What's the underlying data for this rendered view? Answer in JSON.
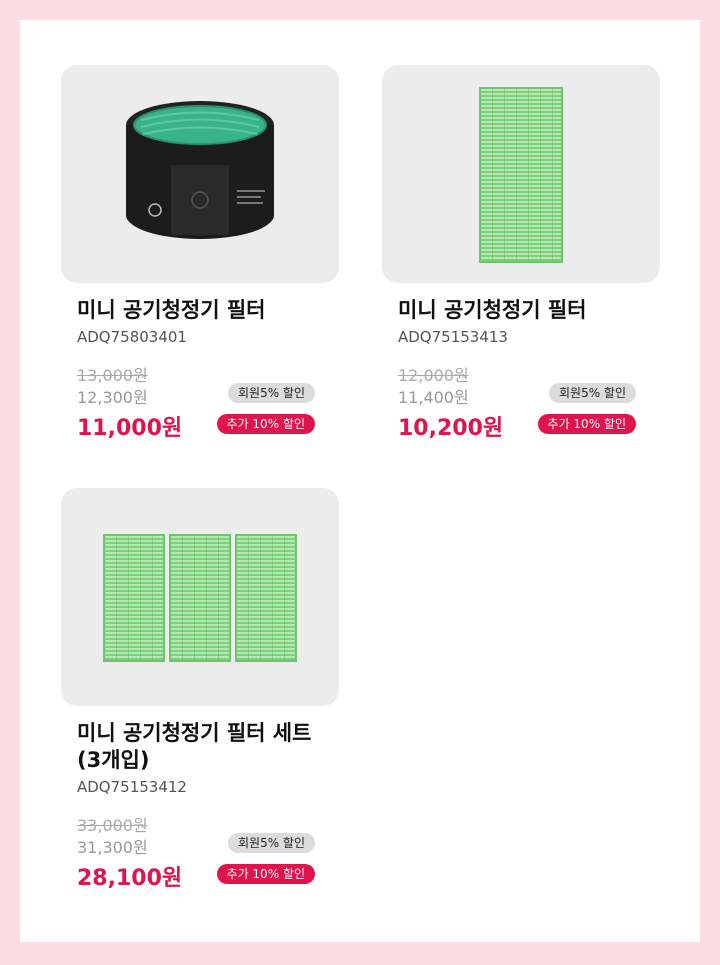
{
  "products": [
    {
      "name": "미니 공기청정기 필터",
      "code": "ADQ75803401",
      "original_price": "13,000원",
      "member_price": "12,300원",
      "final_price": "11,000원",
      "member_badge": "회원5% 할인",
      "extra_badge": "추가 10% 할인"
    },
    {
      "name": "미니 공기청정기 필터",
      "code": "ADQ75153413",
      "original_price": "12,000원",
      "member_price": "11,400원",
      "final_price": "10,200원",
      "member_badge": "회원5% 할인",
      "extra_badge": "추가 10% 할인"
    },
    {
      "name": "미니 공기청정기 필터 세트 (3개입)",
      "code": "ADQ75153412",
      "original_price": "33,000원",
      "member_price": "31,300원",
      "final_price": "28,100원",
      "member_badge": "회원5% 할인",
      "extra_badge": "추가 10% 할인"
    }
  ],
  "colors": {
    "page_background": "#fbdde2",
    "accent_red": "#e0144c",
    "filter_green": "#7fd07e"
  }
}
